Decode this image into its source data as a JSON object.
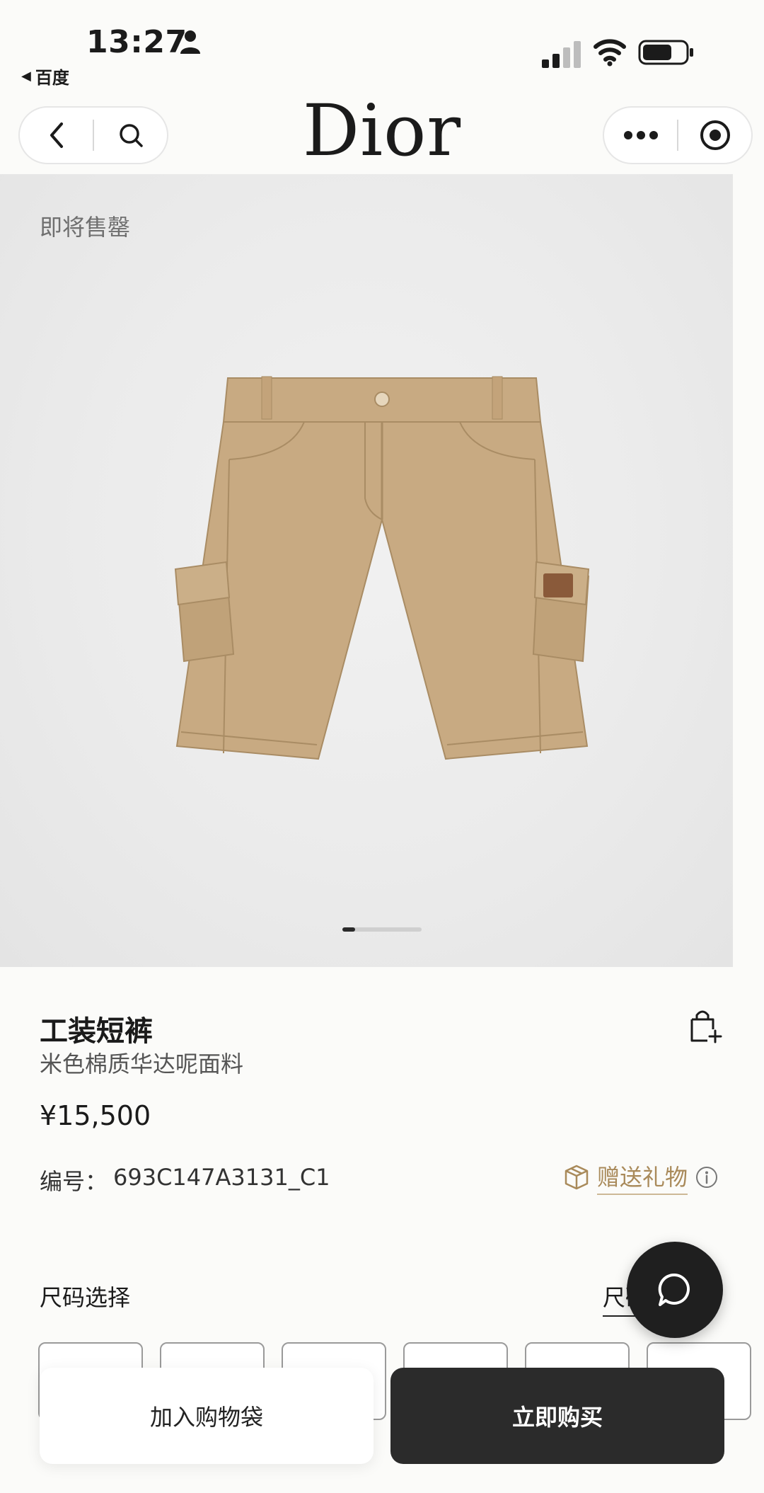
{
  "status_bar": {
    "time": "13:27",
    "back_app_label": "百度",
    "icons": [
      "person-icon",
      "signal-icon",
      "wifi-icon",
      "battery-icon"
    ]
  },
  "nav": {
    "logo": "Dior",
    "left_icons": [
      "chevron-left-icon",
      "search-icon"
    ],
    "right_icons": [
      "more-icon",
      "target-icon"
    ]
  },
  "hero": {
    "badge": "即将售罄",
    "image_subject": "beige cargo shorts",
    "carousel_position": 1
  },
  "product": {
    "title": "工装短裤",
    "subtitle": "米色棉质华达呢面料",
    "price": "¥15,500",
    "sku_label": "编号：",
    "sku_value": "693C147A3131_C1",
    "gift_label": "赠送礼物"
  },
  "size": {
    "label": "尺码选择",
    "guide_label": "尺码指南",
    "options_count": 6
  },
  "actions": {
    "add_to_cart": "加入购物袋",
    "buy_now": "立即购买"
  },
  "colors": {
    "accent_gold": "#a98a5a",
    "dark": "#2b2b2b",
    "shorts": "#c8aa82"
  }
}
